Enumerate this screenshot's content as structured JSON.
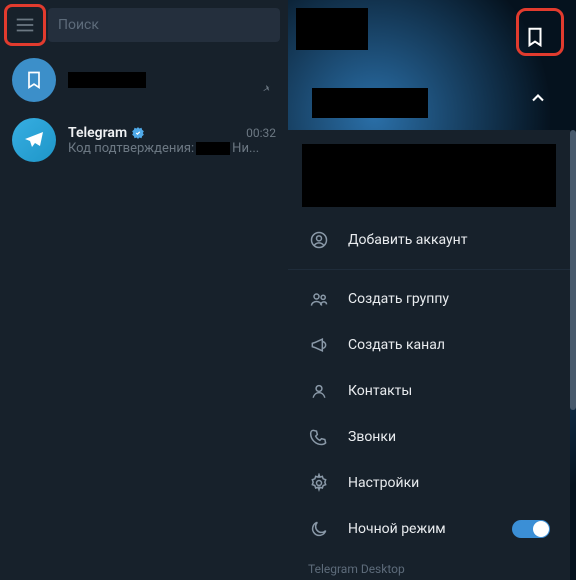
{
  "search": {
    "placeholder": "Поиск"
  },
  "chats": [
    {
      "title_redacted": true,
      "pinned": true
    },
    {
      "title": "Telegram",
      "verified": true,
      "time": "00:32",
      "preview_prefix": "Код подтверждения:",
      "preview_suffix": "Ни..."
    }
  ],
  "drawer": {
    "add_account": "Добавить аккаунт",
    "new_group": "Создать группу",
    "new_channel": "Создать канал",
    "contacts": "Контакты",
    "calls": "Звонки",
    "settings": "Настройки",
    "night_mode": "Ночной режим",
    "footer": "Telegram Desktop"
  }
}
